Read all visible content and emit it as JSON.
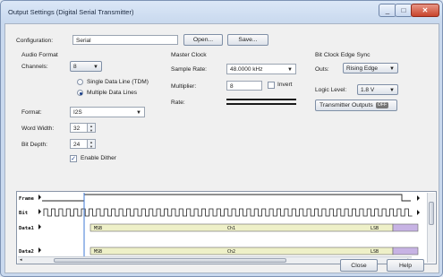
{
  "window": {
    "title": "Output Settings (Digital Serial Transmitter)"
  },
  "config": {
    "label": "Configuration:",
    "value": "Serial",
    "open_btn": "Open...",
    "save_btn": "Save..."
  },
  "audio_format": {
    "header": "Audio Format",
    "channels_label": "Channels:",
    "channels_value": "8",
    "radio_single": "Single Data Line (TDM)",
    "radio_multiple": "Multiple Data Lines",
    "format_label": "Format:",
    "format_value": "I2S",
    "word_width_label": "Word Width:",
    "word_width_value": "32",
    "bit_depth_label": "Bit Depth:",
    "bit_depth_value": "24",
    "dither_label": "Enable Dither"
  },
  "master_clock": {
    "header": "Master Clock",
    "sample_rate_label": "Sample Rate:",
    "sample_rate_value": "48.0000 kHz",
    "multiplier_label": "Multiplier:",
    "multiplier_value": "8",
    "invert_label": "Invert",
    "rate_label": "Rate:"
  },
  "bit_clock": {
    "header": "Bit Clock Edge Sync",
    "outs_label": "Outs:",
    "outs_value": "Rising Edge",
    "logic_label": "Logic Level:",
    "logic_value": "1.8 V",
    "transmitter_label": "Transmitter Outputs",
    "transmitter_state": "OFF"
  },
  "timing": {
    "signals": [
      "Frame",
      "Bit",
      "Data1",
      "Data2"
    ],
    "data1_labels": [
      "MSB",
      "Ch1",
      "LSB"
    ],
    "data2_labels": [
      "MSB",
      "Ch2",
      "LSB"
    ]
  },
  "buttons": {
    "close": "Close",
    "help": "Help"
  },
  "colors": {
    "data_band": "#eef0c8",
    "cursor": "#3f79d6",
    "data_end": "#c7b3e4"
  }
}
